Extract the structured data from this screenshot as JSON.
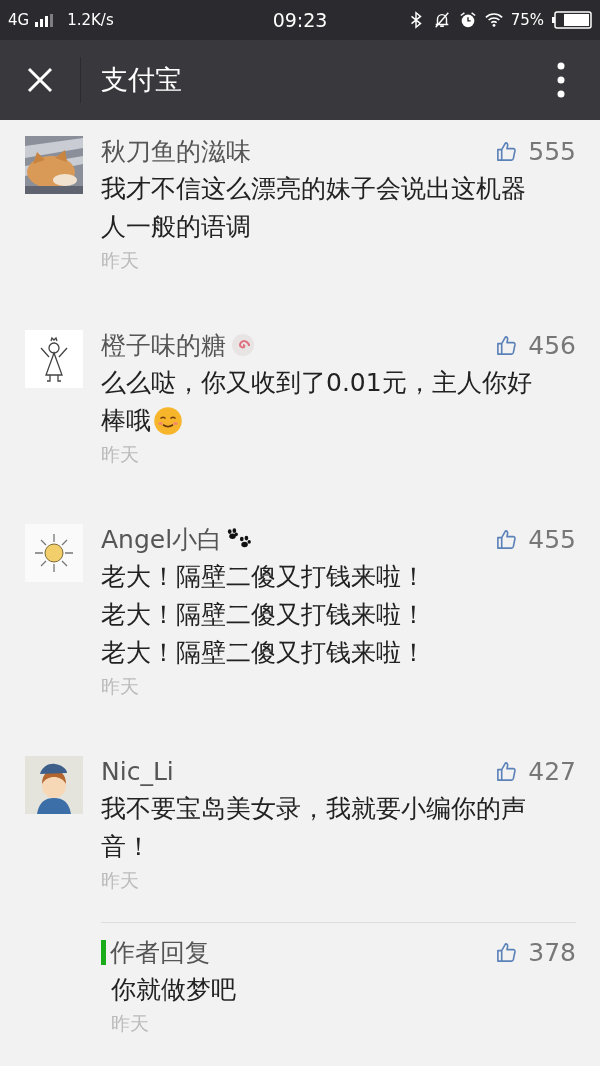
{
  "status_bar": {
    "network": "4G",
    "speed": "1.2K/s",
    "time": "09:23",
    "battery": "75%"
  },
  "header": {
    "title": "支付宝"
  },
  "comments": [
    {
      "avatar": {
        "kind": "cat"
      },
      "name": "秋刀鱼的滋味",
      "likes": "555",
      "lines": [
        "我才不信这么漂亮的妹子会说出这机器",
        "人一般的语调"
      ],
      "date": "昨天"
    },
    {
      "avatar": {
        "kind": "stick"
      },
      "name": "橙子味的糖",
      "badge": {
        "kind": "swirl"
      },
      "likes": "456",
      "lines": [
        "么么哒，你又收到了0.01元，主人你好",
        "棒哦"
      ],
      "emoji": {
        "kind": "smile"
      },
      "date": "昨天"
    },
    {
      "avatar": {
        "kind": "sun"
      },
      "name": "Angel小白",
      "badge": {
        "kind": "paw"
      },
      "likes": "455",
      "lines": [
        "老大！隔壁二傻又打钱来啦！",
        "老大！隔壁二傻又打钱来啦！",
        "老大！隔壁二傻又打钱来啦！"
      ],
      "date": "昨天"
    },
    {
      "avatar": {
        "kind": "boy"
      },
      "name": "Nic_Li",
      "likes": "427",
      "lines": [
        "我不要宝岛美女录，我就要小编你的声",
        "音！"
      ],
      "date": "昨天",
      "reply": {
        "label": "作者回复",
        "likes": "378",
        "lines": [
          "你就做梦吧"
        ],
        "date": "昨天"
      }
    }
  ]
}
